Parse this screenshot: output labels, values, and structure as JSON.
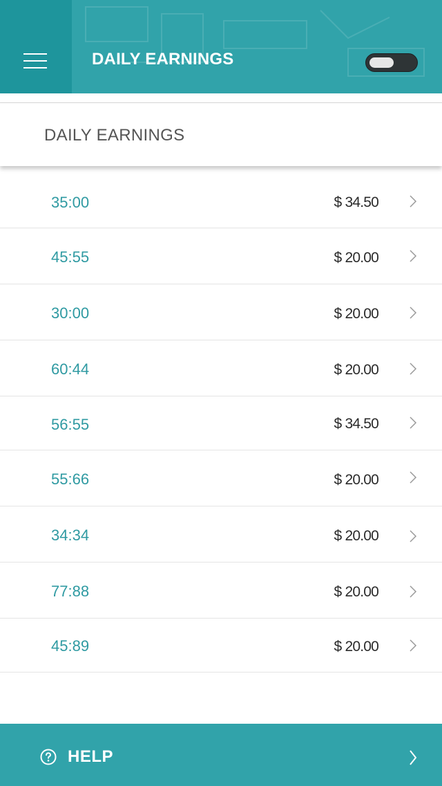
{
  "header": {
    "title": "DAILY EARNINGS",
    "toggle_state": "off"
  },
  "subheader": {
    "title": "DAILY EARNINGS"
  },
  "earnings": [
    {
      "time": "35:00",
      "amount": "$ 34.50"
    },
    {
      "time": "45:55",
      "amount": "$ 20.00"
    },
    {
      "time": "30:00",
      "amount": "$ 20.00"
    },
    {
      "time": "60:44",
      "amount": "$ 20.00"
    },
    {
      "time": "56:55",
      "amount": "$ 34.50"
    },
    {
      "time": "55:66",
      "amount": "$ 20.00"
    },
    {
      "time": "34:34",
      "amount": "$ 20.00"
    },
    {
      "time": "77:88",
      "amount": "$ 20.00"
    },
    {
      "time": "45:89",
      "amount": "$ 20.00"
    }
  ],
  "footer": {
    "help_label": "HELP"
  },
  "colors": {
    "primary": "#31a3aa",
    "primary_dark": "#1e959c",
    "time_text": "#2f9aa2",
    "amount_text": "#2b2b2b"
  },
  "icons": {
    "menu": "hamburger-icon",
    "toggle": "toggle-switch",
    "row": "chevron-right-icon",
    "help": "question-circle-icon"
  }
}
